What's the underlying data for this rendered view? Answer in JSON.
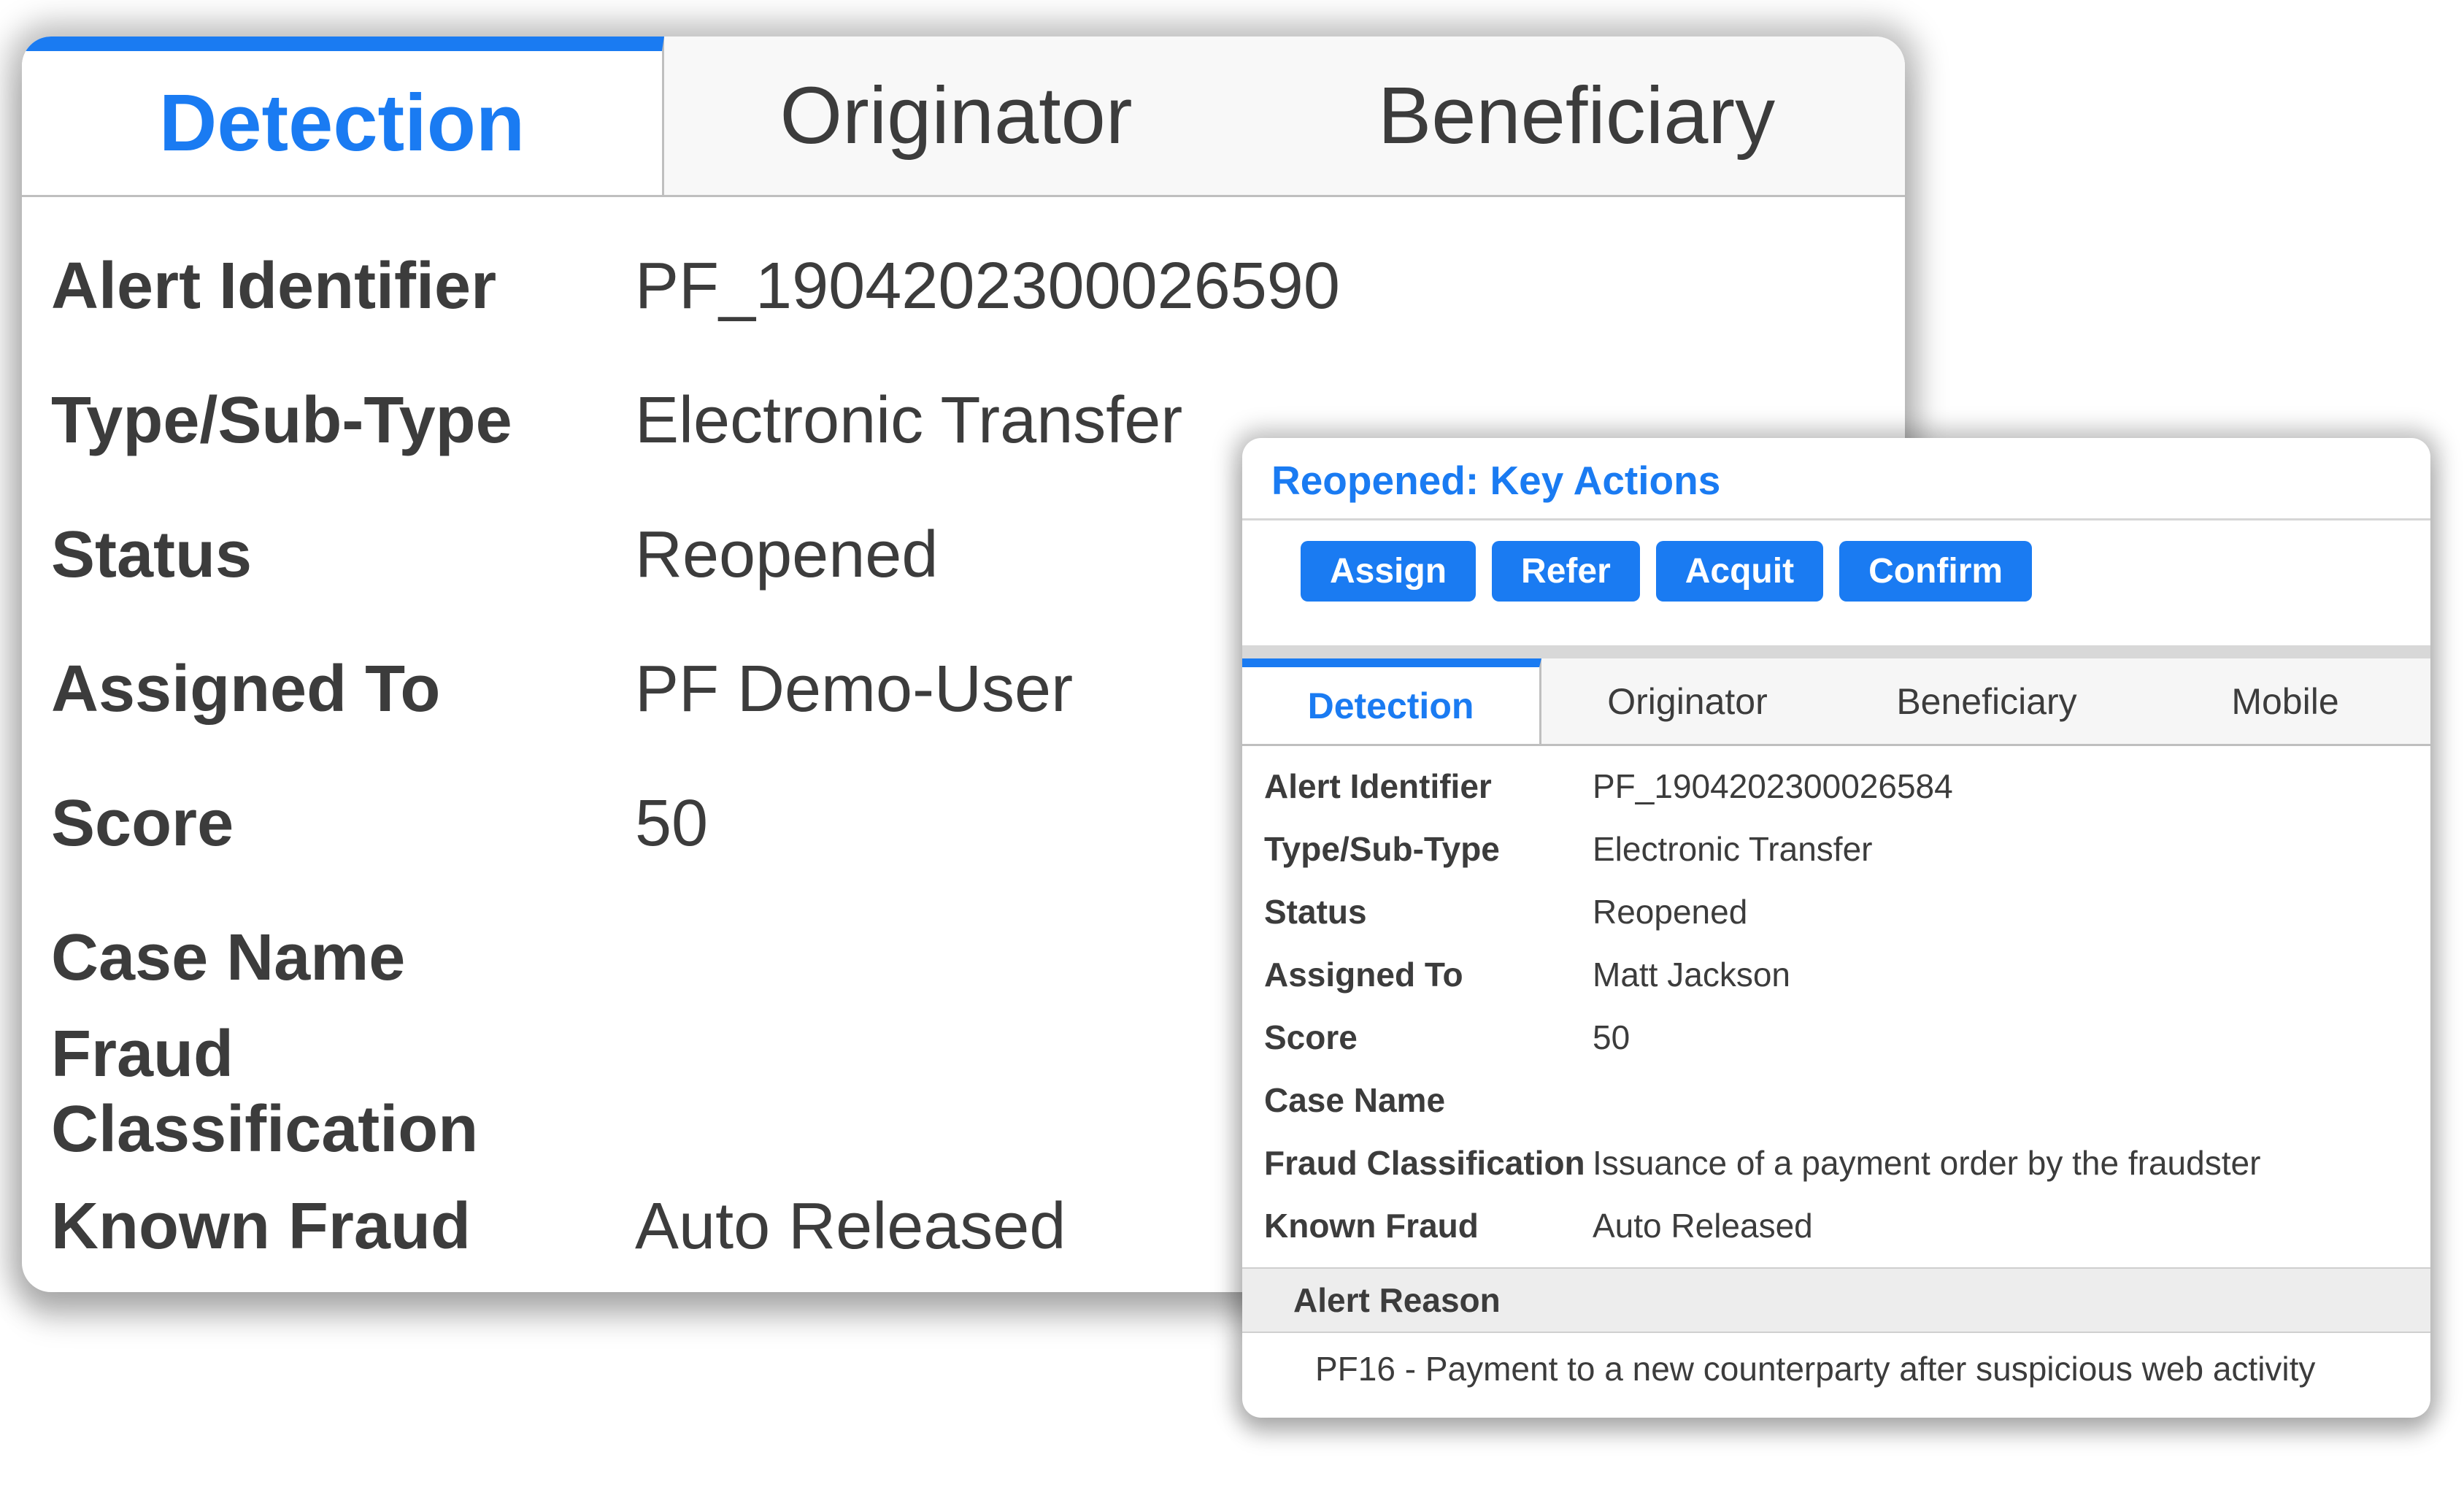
{
  "big_card": {
    "tabs": {
      "detection": "Detection",
      "originator": "Originator",
      "beneficiary": "Beneficiary"
    },
    "labels": {
      "alert_identifier": "Alert Identifier",
      "type_sub_type": "Type/Sub-Type",
      "status": "Status",
      "assigned_to": "Assigned To",
      "score": "Score",
      "case_name": "Case Name",
      "fraud_classification": "Fraud Classification",
      "known_fraud": "Known Fraud"
    },
    "values": {
      "alert_identifier": "PF_1904202300026590",
      "type_sub_type": "Electronic Transfer",
      "status": "Reopened",
      "assigned_to": "PF Demo-User",
      "score": "50",
      "case_name": "",
      "fraud_classification": "",
      "known_fraud": "Auto Released"
    }
  },
  "small_card": {
    "key_actions": {
      "title": "Reopened: Key Actions",
      "assign": "Assign",
      "refer": "Refer",
      "acquit": "Acquit",
      "confirm": "Confirm"
    },
    "tabs": {
      "detection": "Detection",
      "originator": "Originator",
      "beneficiary": "Beneficiary",
      "mobile": "Mobile"
    },
    "labels": {
      "alert_identifier": "Alert Identifier",
      "type_sub_type": "Type/Sub-Type",
      "status": "Status",
      "assigned_to": "Assigned To",
      "score": "Score",
      "case_name": "Case Name",
      "fraud_classification": "Fraud Classification",
      "known_fraud": "Known Fraud"
    },
    "values": {
      "alert_identifier": "PF_1904202300026584",
      "type_sub_type": "Electronic Transfer",
      "status": "Reopened",
      "assigned_to": "Matt Jackson",
      "score": "50",
      "case_name": "",
      "fraud_classification": "Issuance of a payment order by the fraudster",
      "known_fraud": "Auto Released"
    },
    "alert_reason": {
      "heading": "Alert Reason",
      "text": "PF16 - Payment to a new counterparty after suspicious web activity"
    }
  }
}
